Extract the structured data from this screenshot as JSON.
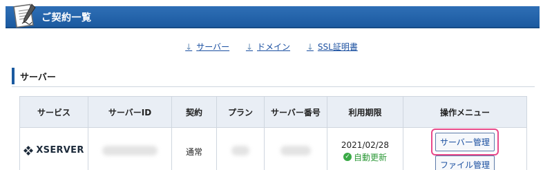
{
  "header": {
    "title": "ご契約一覧",
    "icon": "contract-document-icon",
    "bar_color": "#1b5aa0"
  },
  "anchor_nav": [
    {
      "label": "サーバー",
      "icon": "arrow-down-icon"
    },
    {
      "label": "ドメイン",
      "icon": "arrow-down-icon"
    },
    {
      "label": "SSL証明書",
      "icon": "arrow-down-icon"
    }
  ],
  "section": {
    "title": "サーバー"
  },
  "table": {
    "headers": [
      "サービス",
      "サーバーID",
      "契約",
      "プラン",
      "サーバー番号",
      "利用期限",
      "操作メニュー"
    ],
    "rows": [
      {
        "service": "XSERVER",
        "server_id": "",
        "contract": "通常",
        "plan": "",
        "server_number": "",
        "expiry_date": "2021/02/28",
        "auto_renew": "自動更新",
        "server_admin_button": "サーバー管理",
        "file_admin_button": "ファイル管理"
      }
    ]
  },
  "colors": {
    "accent": "#1b5aa0",
    "link": "#1a4fa0",
    "highlight": "#e8488a",
    "renew_green": "#3aaa46"
  }
}
